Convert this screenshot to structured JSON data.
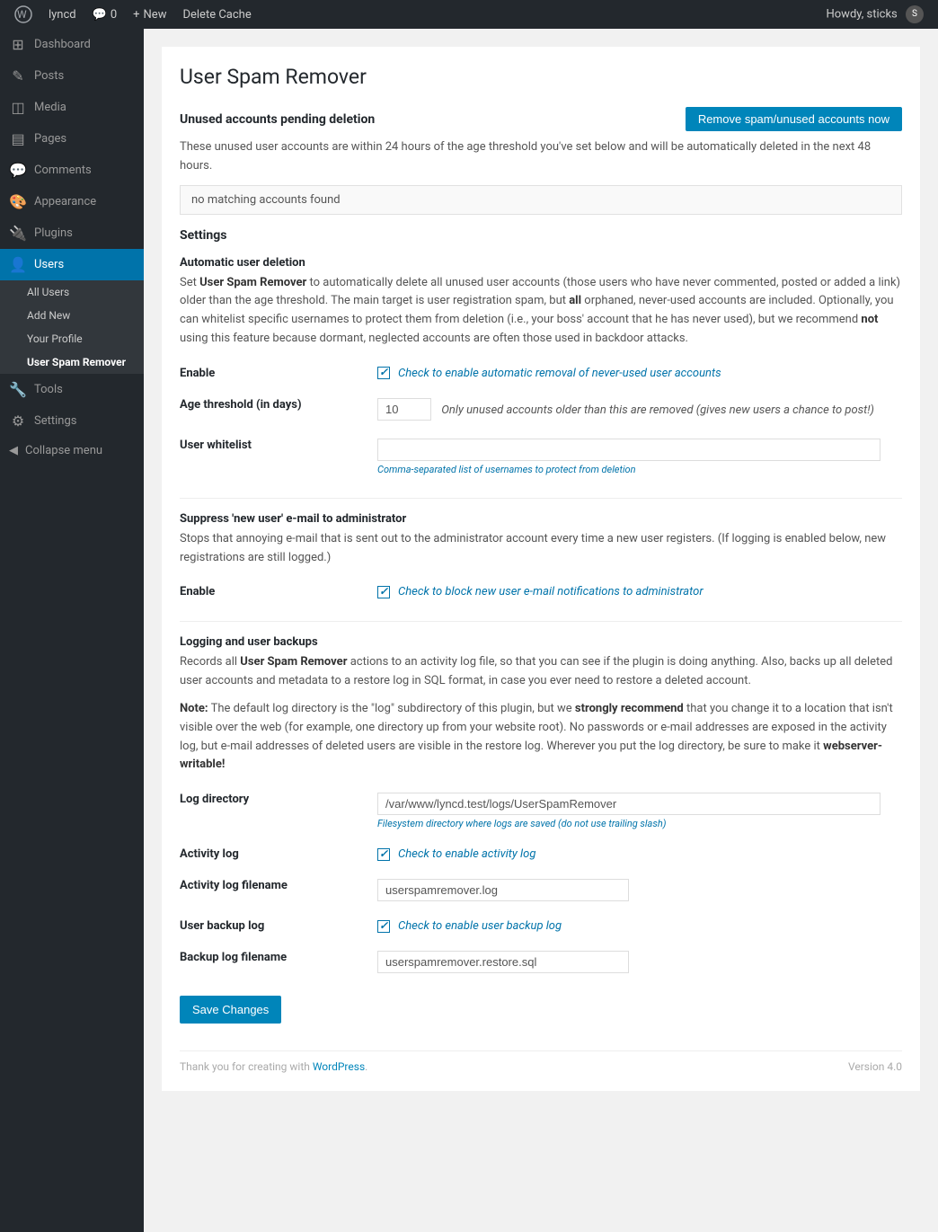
{
  "adminbar": {
    "site_name": "lyncd",
    "comments_count": "0",
    "new_label": "New",
    "delete_cache_label": "Delete Cache",
    "howdy": "Howdy, sticks"
  },
  "sidebar": {
    "items": [
      {
        "id": "dashboard",
        "icon": "⊞",
        "label": "Dashboard"
      },
      {
        "id": "posts",
        "icon": "✎",
        "label": "Posts"
      },
      {
        "id": "media",
        "icon": "◫",
        "label": "Media"
      },
      {
        "id": "pages",
        "icon": "▤",
        "label": "Pages"
      },
      {
        "id": "comments",
        "icon": "💬",
        "label": "Comments"
      },
      {
        "id": "appearance",
        "icon": "🎨",
        "label": "Appearance"
      },
      {
        "id": "plugins",
        "icon": "🔌",
        "label": "Plugins"
      },
      {
        "id": "users",
        "icon": "👤",
        "label": "Users",
        "current": true
      },
      {
        "id": "tools",
        "icon": "🔧",
        "label": "Tools"
      },
      {
        "id": "settings",
        "icon": "⚙",
        "label": "Settings"
      }
    ],
    "users_submenu": [
      {
        "id": "all-users",
        "label": "All Users"
      },
      {
        "id": "add-new",
        "label": "Add New"
      },
      {
        "id": "your-profile",
        "label": "Your Profile"
      },
      {
        "id": "user-spam-remover",
        "label": "User Spam Remover",
        "current": true
      }
    ],
    "collapse_label": "Collapse menu"
  },
  "page": {
    "title": "User Spam Remover",
    "unused_section": {
      "heading": "Unused accounts pending deletion",
      "remove_button": "Remove spam/unused accounts now",
      "description": "These unused user accounts are within 24 hours of the age threshold you've set below and will be automatically deleted in the next 48 hours.",
      "no_match": "no matching accounts found"
    },
    "settings_heading": "Settings",
    "auto_delete": {
      "heading": "Automatic user deletion",
      "description_before": "Set ",
      "description_plugin": "User Spam Remover",
      "description_after": " to automatically delete all unused user accounts (those users who have never commented, posted or added a link) older than the age threshold. The main target is user registration spam, but ",
      "description_all": "all",
      "description_middle": " orphaned, never-used accounts are included. Optionally, you can whitelist specific usernames to protect them from deletion (i.e., your boss' account that he has never used), but we recommend ",
      "description_not": "not",
      "description_end": " using this feature because dormant, neglected accounts are often those used in backdoor attacks.",
      "enable_label": "Enable",
      "enable_check_text": "Check to enable automatic removal of never-used user accounts",
      "age_label": "Age threshold (in days)",
      "age_value": "10",
      "age_hint": "Only unused accounts older than this are removed (gives new users a chance to post!)",
      "whitelist_label": "User whitelist",
      "whitelist_value": "",
      "whitelist_placeholder": "",
      "whitelist_hint": "Comma-separated list of usernames to protect from deletion"
    },
    "suppress_section": {
      "heading": "Suppress 'new user' e-mail to administrator",
      "description": "Stops that annoying e-mail that is sent out to the administrator account every time a new user registers. (If logging is enabled below, new registrations are still logged.)",
      "enable_label": "Enable",
      "enable_check_text": "Check to block new user e-mail notifications to administrator"
    },
    "logging_section": {
      "heading": "Logging and user backups",
      "description_before": "Records all ",
      "description_plugin": "User Spam Remover",
      "description_after": " actions to an activity log file, so that you can see if the plugin is doing anything. Also, backs up all deleted user accounts and metadata to a restore log in SQL format, in case you ever need to restore a deleted account.",
      "note_before": "Note:",
      "note_text": " The default log directory is the \"log\" subdirectory of this plugin, but we ",
      "note_strong": "strongly recommend",
      "note_after": " that you change it to a location that isn't visible over the web (for example, one directory up from your website root). No passwords or e-mail addresses are exposed in the activity log, but e-mail addresses of deleted users are visible in the restore log. Wherever you put the log directory, be sure to make it ",
      "note_writable": "webserver-writable!",
      "log_dir_label": "Log directory",
      "log_dir_value": "/var/www/lyncd.test/logs/UserSpamRemover",
      "log_dir_hint": "Filesystem directory where logs are saved (do not use trailing slash)",
      "activity_log_label": "Activity log",
      "activity_log_check": "Check to enable activity log",
      "activity_filename_label": "Activity log filename",
      "activity_filename_value": "userspamremover.log",
      "backup_log_label": "User backup log",
      "backup_log_check": "Check to enable user backup log",
      "backup_filename_label": "Backup log filename",
      "backup_filename_value": "userspamremover.restore.sql"
    },
    "save_button": "Save Changes",
    "footer": {
      "thanks": "Thank you for creating with ",
      "wp_link": "WordPress",
      "wp_url": "#",
      "version": "Version 4.0"
    }
  }
}
